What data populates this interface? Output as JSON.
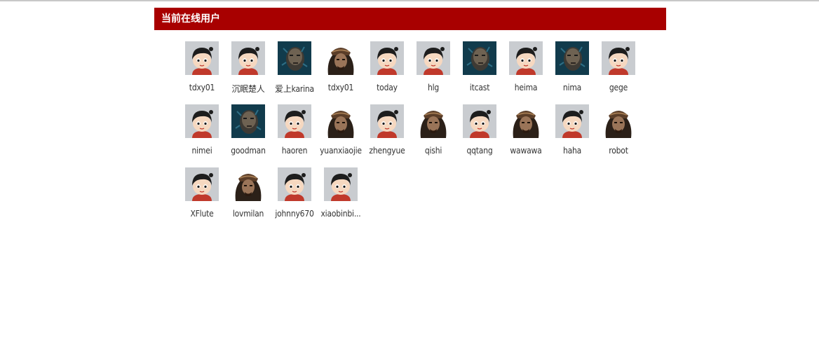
{
  "panel": {
    "title": "当前在线用户"
  },
  "colors": {
    "header_bg": "#a80000",
    "header_text": "#ffffff",
    "name_text": "#333333"
  },
  "users": [
    {
      "name": "tdxy01",
      "avatar": "cartoon-avatar-icon"
    },
    {
      "name": "沉眠楚人",
      "avatar": "cartoon-avatar-icon"
    },
    {
      "name": "爱上karina",
      "avatar": "dark-portrait-avatar-icon"
    },
    {
      "name": "tdxy01",
      "avatar": "pirate-avatar-icon"
    },
    {
      "name": "today",
      "avatar": "cartoon-avatar-icon"
    },
    {
      "name": "hlg",
      "avatar": "cartoon-avatar-icon"
    },
    {
      "name": "itcast",
      "avatar": "dark-portrait-avatar-icon"
    },
    {
      "name": "heima",
      "avatar": "cartoon-avatar-icon"
    },
    {
      "name": "nima",
      "avatar": "dark-portrait-avatar-icon"
    },
    {
      "name": "gege",
      "avatar": "cartoon-avatar-icon"
    },
    {
      "name": "nimei",
      "avatar": "cartoon-avatar-icon"
    },
    {
      "name": "goodman",
      "avatar": "dark-portrait-avatar-icon"
    },
    {
      "name": "haoren",
      "avatar": "cartoon-avatar-icon"
    },
    {
      "name": "yuanxiaojie",
      "avatar": "pirate-avatar-icon"
    },
    {
      "name": "zhengyue",
      "avatar": "cartoon-avatar-icon"
    },
    {
      "name": "qishi",
      "avatar": "pirate-avatar-icon"
    },
    {
      "name": "qqtang",
      "avatar": "cartoon-avatar-icon"
    },
    {
      "name": "wawawa",
      "avatar": "pirate-avatar-icon"
    },
    {
      "name": "haha",
      "avatar": "cartoon-avatar-icon"
    },
    {
      "name": "robot",
      "avatar": "pirate-avatar-icon"
    },
    {
      "name": "XFlute",
      "avatar": "cartoon-avatar-icon"
    },
    {
      "name": "lovmilan",
      "avatar": "pirate-avatar-icon"
    },
    {
      "name": "johnny670",
      "avatar": "cartoon-avatar-icon"
    },
    {
      "name": "xiaobinbi...",
      "avatar": "cartoon-avatar-icon"
    }
  ]
}
